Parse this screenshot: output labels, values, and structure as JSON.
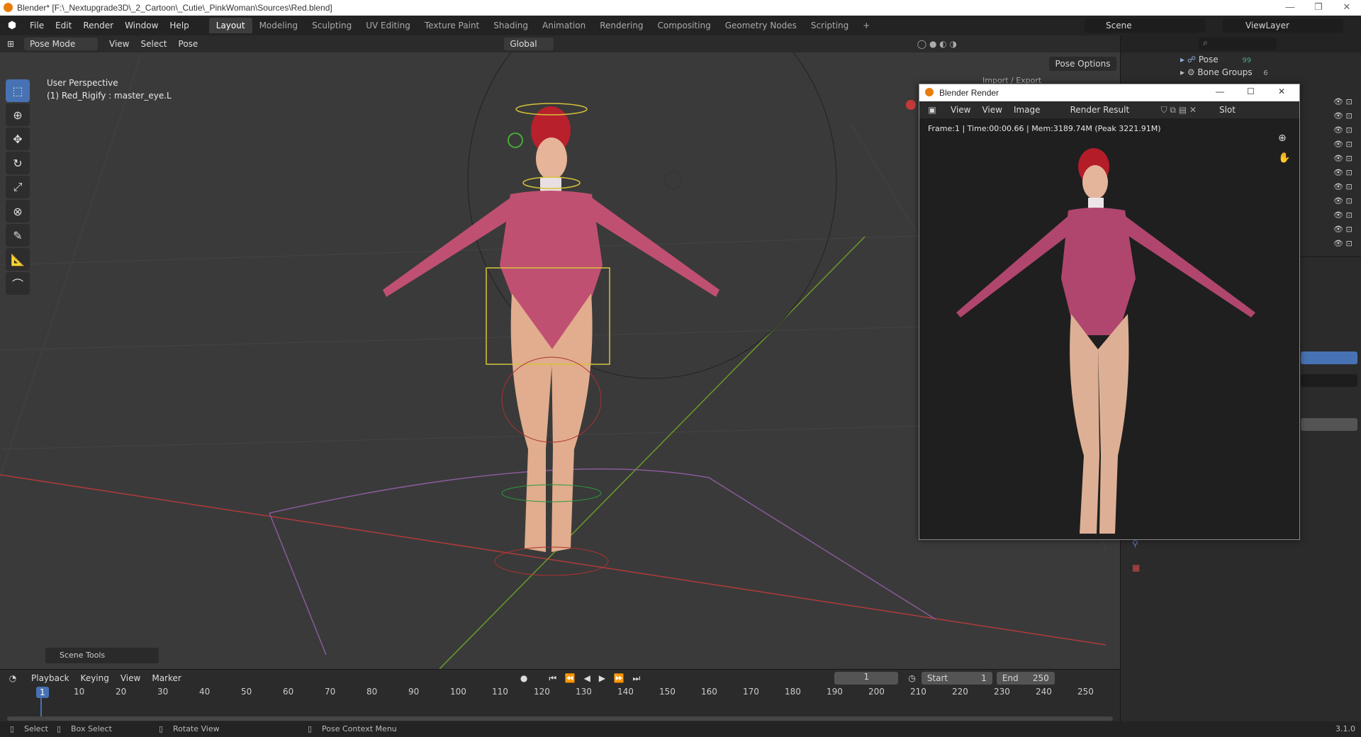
{
  "window_title": "Blender* [F:\\_Nextupgrade3D\\_2_Cartoon\\_Cutie\\_PinkWoman\\Sources\\Red.blend]",
  "menu": [
    "File",
    "Edit",
    "Render",
    "Window",
    "Help"
  ],
  "workspaces": [
    "Layout",
    "Modeling",
    "Sculpting",
    "UV Editing",
    "Texture Paint",
    "Shading",
    "Animation",
    "Rendering",
    "Compositing",
    "Geometry Nodes",
    "Scripting",
    "+"
  ],
  "active_workspace": "Layout",
  "scene": "Scene",
  "view_layer": "ViewLayer",
  "viewport_header": {
    "mode": "Pose Mode",
    "menus": [
      "View",
      "Select",
      "Pose"
    ],
    "orientation": "Global",
    "pose_options": "Pose Options",
    "import_export": "Import / Export"
  },
  "viewport": {
    "perspective_label": "User Perspective",
    "object_label": "(1) Red_Rigify : master_eye.L",
    "scene_tools": "Scene Tools"
  },
  "outliner": {
    "items": [
      {
        "label": "Pose",
        "badge": "99"
      },
      {
        "label": "Bone Groups",
        "badge": "6"
      }
    ]
  },
  "render_window": {
    "title": "Blender Render",
    "view_menu_1": "View",
    "view_menu_2": "View",
    "image_menu": "Image",
    "result_name": "Render Result",
    "slot": "Slot",
    "info": "Frame:1 | Time:00:00.66 | Mem:3189.74M (Peak 3221.91M)"
  },
  "timeline": {
    "menus": [
      "Playback",
      "Keying",
      "View",
      "Marker"
    ],
    "current_frame": "1",
    "start_label": "Start",
    "start": "1",
    "end_label": "End",
    "end": "250",
    "ruler": [
      "1",
      "10",
      "20",
      "30",
      "40",
      "50",
      "60",
      "70",
      "80",
      "90",
      "100",
      "110",
      "120",
      "130",
      "140",
      "150",
      "160",
      "170",
      "180",
      "190",
      "200",
      "210",
      "220",
      "230",
      "240",
      "250"
    ]
  },
  "statusbar": {
    "select": "Select",
    "box_select": "Box Select",
    "rotate_view": "Rotate View",
    "context_menu": "Pose Context Menu",
    "version": "3.1.0"
  },
  "colors": {
    "accent": "#4772b3",
    "viewport_bg": "#3a3a3a",
    "panel_bg": "#2b2b2b",
    "x_axis": "#c04040",
    "y_axis": "#6a9a2a"
  }
}
